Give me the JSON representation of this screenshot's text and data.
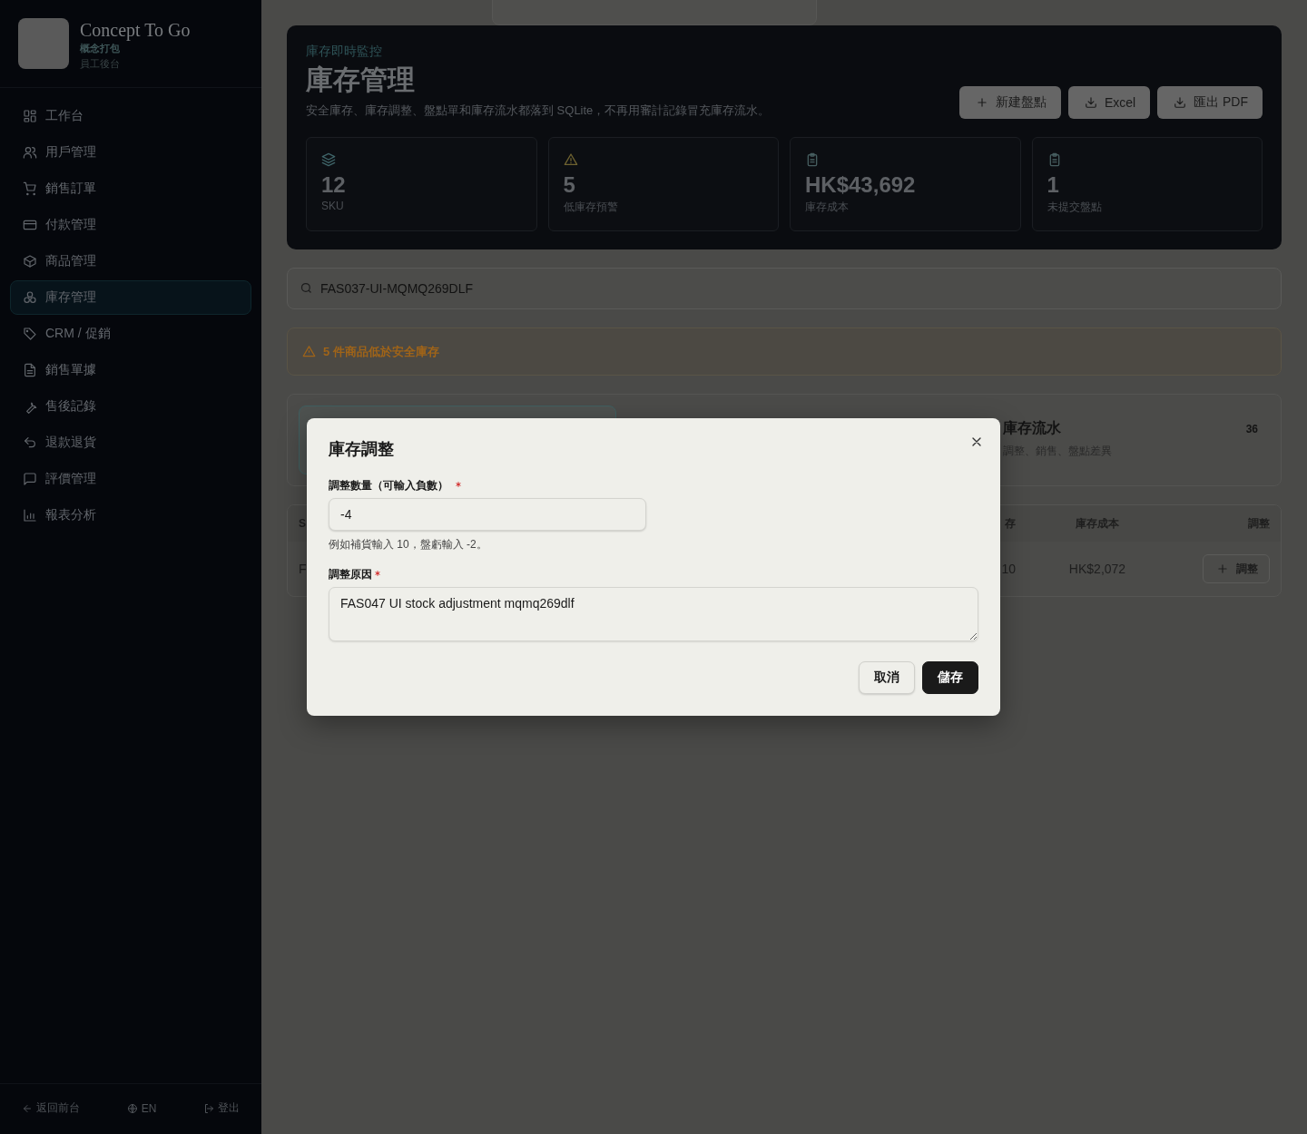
{
  "sidebar": {
    "brand": {
      "name": "Concept To Go",
      "subtitle": "概念打包",
      "caption": "員工後台"
    },
    "items": [
      {
        "label": "工作台",
        "selected": false
      },
      {
        "label": "用戶管理",
        "selected": false
      },
      {
        "label": "銷售訂單",
        "selected": false
      },
      {
        "label": "付款管理",
        "selected": false
      },
      {
        "label": "商品管理",
        "selected": false
      },
      {
        "label": "庫存管理",
        "selected": true
      },
      {
        "label": "CRM / 促銷",
        "selected": false
      },
      {
        "label": "銷售單據",
        "selected": false
      },
      {
        "label": "售後記錄",
        "selected": false
      },
      {
        "label": "退款退貨",
        "selected": false
      },
      {
        "label": "評價管理",
        "selected": false
      },
      {
        "label": "報表分析",
        "selected": false
      }
    ],
    "footer": [
      {
        "label": "返回前台"
      },
      {
        "label": "EN"
      },
      {
        "label": "登出"
      }
    ]
  },
  "header": {
    "eyebrow": "庫存即時監控",
    "title": "庫存管理",
    "description": "安全庫存、庫存調整、盤點單和庫存流水都落到 SQLite，不再用審計記錄冒充庫存流水。",
    "buttons": [
      {
        "label": "新建盤點"
      },
      {
        "label": "Excel"
      },
      {
        "label": "匯出 PDF"
      }
    ],
    "stats": [
      {
        "value": "12",
        "label": "SKU"
      },
      {
        "value": "5",
        "label": "低庫存預警"
      },
      {
        "value": "HK$43,692",
        "label": "庫存成本"
      },
      {
        "value": "1",
        "label": "未提交盤點"
      }
    ]
  },
  "search": {
    "value": "FAS037-UI-MQMQ269DLF"
  },
  "alert": {
    "text": "5 件商品低於安全庫存"
  },
  "tabs": [
    {
      "selected": true
    },
    {
      "selected": false
    },
    {
      "title": "庫存流水",
      "subtitle": "調整、銷售、盤點差異",
      "count": "36",
      "selected": false
    }
  ],
  "table": {
    "columns": [
      "S",
      "存",
      "庫存成本",
      "調整"
    ],
    "rows": [
      {
        "column_1": "F",
        "column_2": "10",
        "cost": "HK$2,072",
        "action": "調整"
      }
    ]
  },
  "dialog": {
    "title": "庫存調整",
    "fields": [
      {
        "kind": "input",
        "label": "調整數量（可輸入負數）",
        "required": true,
        "value": "-4",
        "hint": "例如補貨輸入 10，盤虧輸入 -2。"
      },
      {
        "kind": "textarea",
        "label": "調整原因",
        "required": true,
        "value": "FAS047 UI stock adjustment mqmq269dlf"
      }
    ],
    "buttons": [
      {
        "label": "取消",
        "primary": false
      },
      {
        "label": "儲存",
        "primary": true
      }
    ]
  }
}
